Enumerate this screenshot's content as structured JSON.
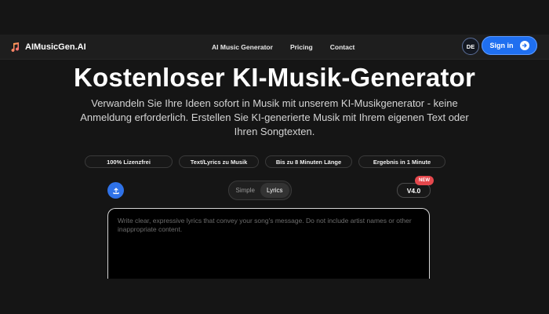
{
  "header": {
    "brand_name": "AIMusicGen.AI",
    "nav_links": [
      "AI Music Generator",
      "Pricing",
      "Contact"
    ],
    "language": "DE",
    "signin_label": "Sign in",
    "signin_icon": "arrow-right-circle-icon",
    "brand_icon": "music-note-icon"
  },
  "hero": {
    "title": "Kostenloser KI-Musik-Generator",
    "subtitle": "Verwandeln Sie Ihre Ideen sofort in Musik mit unserem KI-Musikgenerator - keine Anmeldung erforderlich. Erstellen Sie KI-generierte Musik mit Ihrem eigenen Text oder Ihren Songtexten."
  },
  "badges": [
    "100% Lizenzfrei",
    "Text/Lyrics zu Musik",
    "Bis zu 8 Minuten Länge",
    "Ergebnis in 1 Minute"
  ],
  "controls": {
    "upload_icon": "upload-icon",
    "modes": [
      "Simple",
      "Lyrics"
    ],
    "active_mode": "Lyrics",
    "version": "V4.0",
    "new_badge": "NEW"
  },
  "editor": {
    "placeholder": "Write clear, expressive lyrics that convey your song's message. Do not include artist names or other inappropriate content.",
    "value": ""
  },
  "colors": {
    "background": "#151515",
    "accent": "#1f6ff0",
    "new_badge": "#e5484d"
  }
}
